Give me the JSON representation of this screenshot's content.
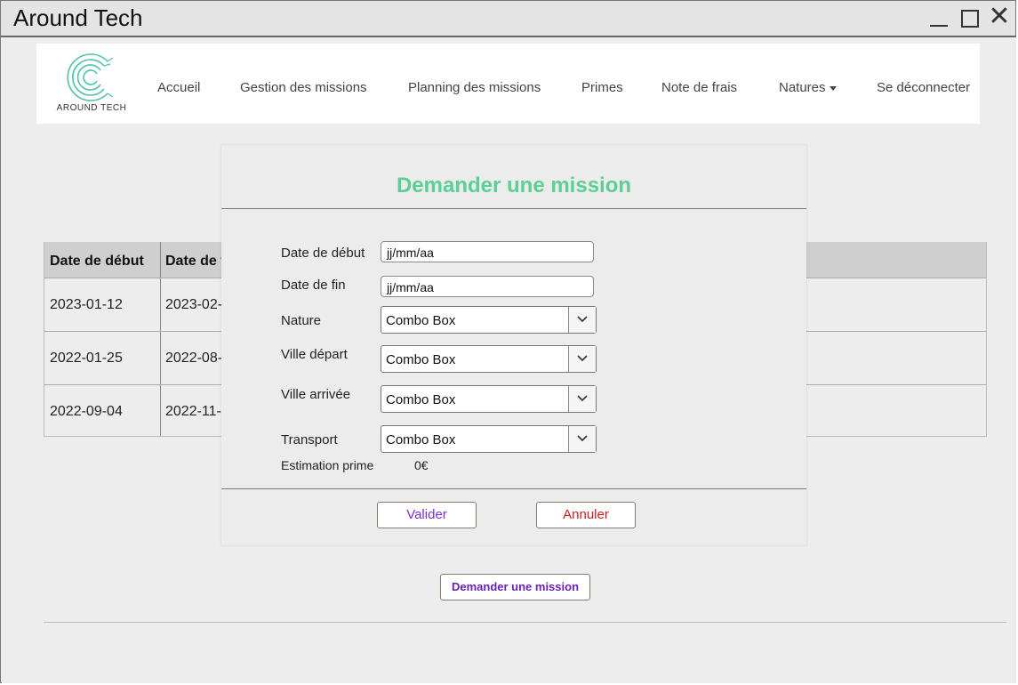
{
  "window": {
    "title": "Around Tech"
  },
  "navbar": {
    "logo_text": "AROUND TECH",
    "items": [
      {
        "label": "Accueil"
      },
      {
        "label": "Gestion des missions"
      },
      {
        "label": "Planning des missions"
      },
      {
        "label": "Primes"
      },
      {
        "label": "Note de frais"
      },
      {
        "label": "Natures"
      },
      {
        "label": "Se déconnecter"
      }
    ]
  },
  "table": {
    "headers": [
      "Date de début",
      "Date de f"
    ],
    "rows": [
      [
        "2023-01-12",
        "2023-02-"
      ],
      [
        "2022-01-25",
        "2022-08-"
      ],
      [
        "2022-09-04",
        "2022-11-"
      ]
    ]
  },
  "modal": {
    "title": "Demander une mission",
    "fields": {
      "date_debut_label": "Date de début",
      "date_debut_placeholder": "jj/mm/aa",
      "date_fin_label": "Date de fin",
      "date_fin_placeholder": "jj/mm/aa",
      "nature_label": "Nature",
      "nature_value": "Combo Box",
      "ville_depart_label": "Ville départ",
      "ville_depart_value": "Combo Box",
      "ville_arrivee_label": "Ville arrivée",
      "ville_arrivee_value": "Combo Box",
      "transport_label": "Transport",
      "transport_value": "Combo Box",
      "estimation_label": "Estimation prime",
      "estimation_value": "0€"
    },
    "buttons": {
      "valider": "Valider",
      "annuler": "Annuler"
    }
  },
  "main_button": "Demander une mission",
  "colors": {
    "accent_green": "#5ccf95",
    "valider_text": "#7b2fc9",
    "annuler_text": "#c81e1e",
    "main_button_text": "#6a1fb5"
  }
}
